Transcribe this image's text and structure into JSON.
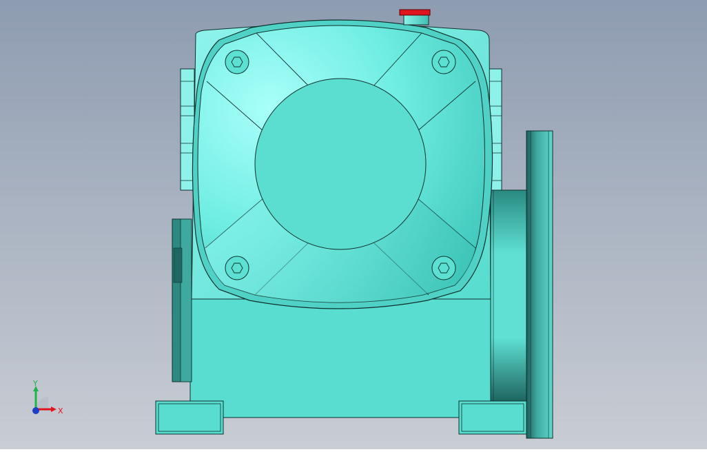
{
  "viewport": {
    "background_top": "#8E9CB1",
    "background_bottom": "#C9CDD4"
  },
  "model": {
    "body_color": "#5CE0D2",
    "body_light": "#8FF3EC",
    "body_dark": "#2E8C84",
    "body_darker": "#1F6762",
    "edge_color": "#0E2F2C",
    "oil_plug_color": "#E0141E"
  },
  "axis_triad": {
    "x_label": "X",
    "y_label": "Y",
    "x_color": "#E0141E",
    "y_color": "#22B14C",
    "z_color": "#1F3CC6"
  }
}
